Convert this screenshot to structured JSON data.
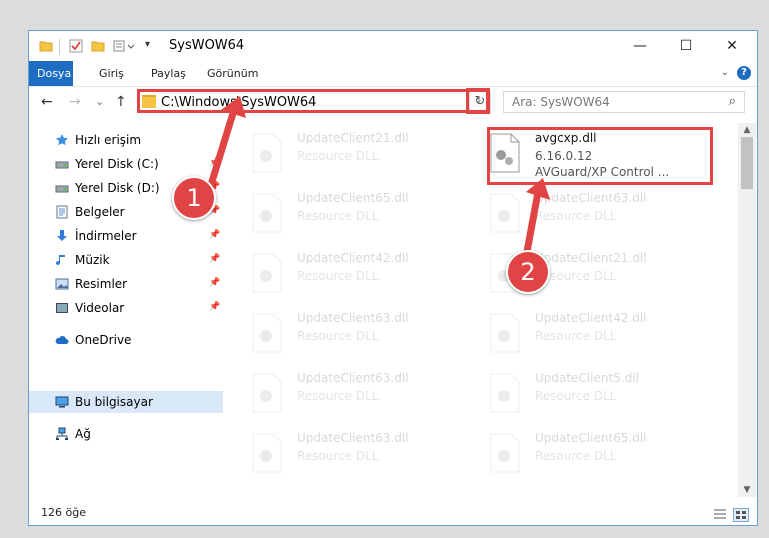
{
  "window": {
    "title": "SysWOW64"
  },
  "window_controls": {
    "minimize": "—",
    "maximize": "☐",
    "close": "✕"
  },
  "ribbon": {
    "tabs": [
      "Dosya",
      "Giriş",
      "Paylaş",
      "Görünüm"
    ],
    "help": "?"
  },
  "navigation": {
    "back": "←",
    "forward": "→",
    "recent": "⌄",
    "up": "↑"
  },
  "address_bar": {
    "path": "C:\\Windows\\SysWOW64"
  },
  "search": {
    "placeholder": "Ara: SysWOW64"
  },
  "sidebar": {
    "items": [
      {
        "label": "Hızlı erişim",
        "icon": "star-icon"
      },
      {
        "label": "Yerel Disk (C:)",
        "icon": "drive-icon"
      },
      {
        "label": "Yerel Disk (D:)",
        "icon": "drive-icon"
      },
      {
        "label": "Belgeler",
        "icon": "documents-icon"
      },
      {
        "label": "İndirmeler",
        "icon": "download-icon"
      },
      {
        "label": "Müzik",
        "icon": "music-icon"
      },
      {
        "label": "Resimler",
        "icon": "pictures-icon"
      },
      {
        "label": "Videolar",
        "icon": "videos-icon"
      },
      {
        "label": "OneDrive",
        "icon": "cloud-icon"
      },
      {
        "label": "Bu bilgisayar",
        "icon": "computer-icon"
      },
      {
        "label": "Ağ",
        "icon": "network-icon"
      }
    ]
  },
  "files": {
    "left": [
      {
        "name": "UpdateClient21.dll",
        "type": "Resource DLL"
      },
      {
        "name": "UpdateClient65.dll",
        "type": "Resource DLL"
      },
      {
        "name": "UpdateClient42.dll",
        "type": "Resource DLL"
      },
      {
        "name": "UpdateClient63.dll",
        "type": "Resource DLL"
      },
      {
        "name": "UpdateClient63.dll",
        "type": "Resource DLL"
      },
      {
        "name": "UpdateClient63.dll",
        "type": "Resource DLL"
      }
    ],
    "right": [
      {
        "name": "UpdateClient63.dll",
        "type": "Resource DLL"
      },
      {
        "name": "UpdateClient21.dll",
        "type": "Resource DLL"
      },
      {
        "name": "UpdateClient42.dll",
        "type": "Resource DLL"
      },
      {
        "name": "UpdateClient5.dll",
        "type": "Resource DLL"
      },
      {
        "name": "UpdateClient65.dll",
        "type": "Resource DLL"
      }
    ],
    "highlighted": {
      "name": "avgcxp.dll",
      "version": "6.16.0.12",
      "description": "AVGuard/XP Control ..."
    }
  },
  "status": {
    "item_count": "126 öğe"
  },
  "annotations": {
    "step1": "1",
    "step2": "2"
  },
  "colors": {
    "highlight": "#e14444",
    "accent": "#1f6cc3"
  }
}
